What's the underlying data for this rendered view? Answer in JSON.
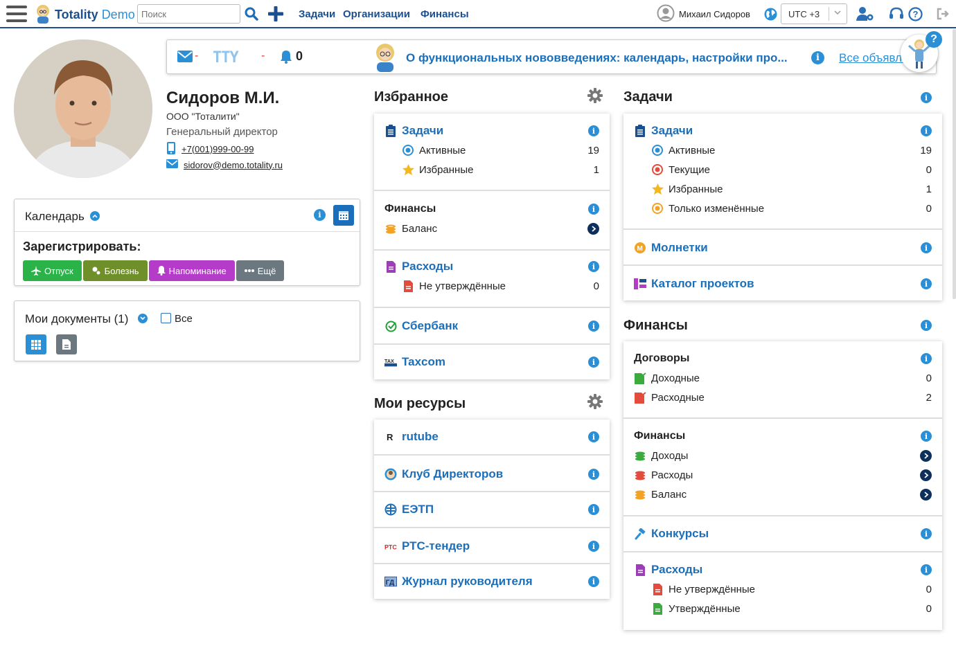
{
  "topbar": {
    "brand_main": "Totality",
    "brand_sub": "Demo",
    "search_placeholder": "Поиск",
    "nav": [
      "Задачи",
      "Организации",
      "Финансы"
    ],
    "user_name": "Михаил Сидоров",
    "timezone": "UTC +3"
  },
  "notify": {
    "mail_count": "-",
    "tty_count": "-",
    "bell_count": "0",
    "announcement": "О функциональных нововведениях: календарь, настройки про...",
    "all_link": "Все объявления"
  },
  "profile": {
    "name": "Сидоров М.И.",
    "org": "ООО \"Тоталити\"",
    "position": "Генеральный директор",
    "phone": "+7(001)999-00-99",
    "email": "sidorov@demo.totality.ru"
  },
  "calendar": {
    "title": "Календарь",
    "register_label": "Зарегистрировать:",
    "buttons": [
      "Отпуск",
      "Болезнь",
      "Напоминание",
      "Ещё"
    ]
  },
  "documents": {
    "title": "Мои документы (1)",
    "all_label": "Все"
  },
  "favorites": {
    "title": "Избранное",
    "tasks": {
      "label": "Задачи",
      "rows": [
        {
          "label": "Активные",
          "count": "19"
        },
        {
          "label": "Избранные",
          "count": "1"
        }
      ]
    },
    "finance": {
      "label": "Финансы",
      "balance": "Баланс"
    },
    "expenses": {
      "label": "Расходы",
      "rows": [
        {
          "label": "Не утверждённые",
          "count": "0"
        }
      ]
    },
    "sber": "Сбербанк",
    "taxcom": "Taxcom"
  },
  "resources": {
    "title": "Мои ресурсы",
    "items": [
      "rutube",
      "Клуб Директоров",
      "ЕЭТП",
      "РТС-тендер",
      "Журнал руководителя"
    ]
  },
  "tasks": {
    "title": "Задачи",
    "header": "Задачи",
    "rows": [
      {
        "label": "Активные",
        "count": "19"
      },
      {
        "label": "Текущие",
        "count": "0"
      },
      {
        "label": "Избранные",
        "count": "1"
      },
      {
        "label": "Только изменённые",
        "count": "0"
      }
    ],
    "molnetki": "Молнетки",
    "catalog": "Каталог проектов"
  },
  "finances": {
    "title": "Финансы",
    "contracts": {
      "label": "Договоры",
      "rows": [
        {
          "label": "Доходные",
          "count": "0"
        },
        {
          "label": "Расходные",
          "count": "2"
        }
      ]
    },
    "finance": {
      "label": "Финансы",
      "rows": [
        "Доходы",
        "Расходы",
        "Баланс"
      ]
    },
    "contests": "Конкурсы",
    "expenses": {
      "label": "Расходы",
      "rows": [
        {
          "label": "Не утверждённые",
          "count": "0"
        },
        {
          "label": "Утверждённые",
          "count": "0"
        }
      ]
    }
  },
  "icons": [
    "menu-icon",
    "search-icon",
    "plus-icon",
    "user-circle-icon",
    "globe-icon",
    "chevron-down-icon",
    "user-settings-icon",
    "headset-icon",
    "help-icon",
    "logout-icon",
    "mail-icon",
    "bell-icon",
    "info-icon",
    "gear-icon",
    "calendar-icon",
    "phone-icon",
    "clipboard-icon",
    "star-icon",
    "coins-icon",
    "document-icon",
    "chevron-right-icon"
  ],
  "colors": {
    "brand": "#1b4f8f",
    "accent": "#2b8fd6",
    "green": "#2bb34a",
    "olive": "#6f8f2a",
    "purple": "#b53bc9",
    "gray": "#6b7880"
  }
}
